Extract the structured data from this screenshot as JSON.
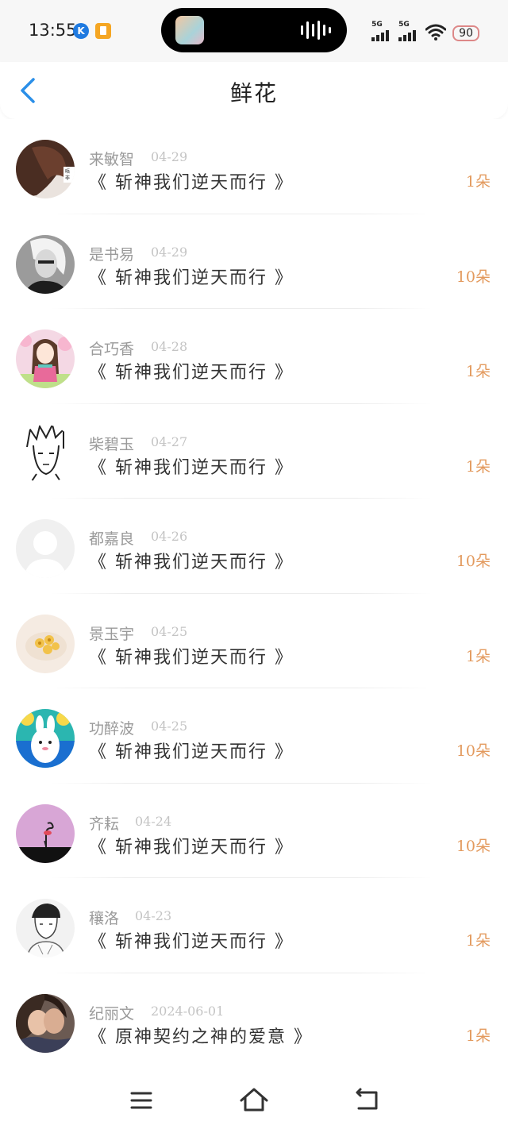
{
  "status_bar": {
    "time": "13:55",
    "k_badge": "K",
    "signal_1": "5G",
    "signal_2": "5G",
    "battery": "90",
    "icons": [
      "k-app-icon",
      "notes-app-icon",
      "wifi-icon",
      "battery-icon"
    ]
  },
  "header": {
    "title": "鲜花",
    "back_icon": "chevron-left-icon",
    "accent_color": "#2b8fe8"
  },
  "items": [
    {
      "name": "来敏智",
      "date": "04-29",
      "book": "《 斩神我们逆天而行 》",
      "count": "1朵",
      "avatar": "avatar-photo-hair"
    },
    {
      "name": "是书易",
      "date": "04-29",
      "book": "《 斩神我们逆天而行 》",
      "count": "10朵",
      "avatar": "avatar-photo-bw"
    },
    {
      "name": "合巧香",
      "date": "04-28",
      "book": "《 斩神我们逆天而行 》",
      "count": "1朵",
      "avatar": "avatar-doll"
    },
    {
      "name": "柴碧玉",
      "date": "04-27",
      "book": "《 斩神我们逆天而行 》",
      "count": "1朵",
      "avatar": "avatar-sketch"
    },
    {
      "name": "都嘉良",
      "date": "04-26",
      "book": "《 斩神我们逆天而行 》",
      "count": "10朵",
      "avatar": "avatar-default"
    },
    {
      "name": "景玉宇",
      "date": "04-25",
      "book": "《 斩神我们逆天而行 》",
      "count": "1朵",
      "avatar": "avatar-food"
    },
    {
      "name": "功醉波",
      "date": "04-25",
      "book": "《 斩神我们逆天而行 》",
      "count": "10朵",
      "avatar": "avatar-cartoon-bunny"
    },
    {
      "name": "齐耘",
      "date": "04-24",
      "book": "《 斩神我们逆天而行 》",
      "count": "10朵",
      "avatar": "avatar-flamingo"
    },
    {
      "name": "穰洛",
      "date": "04-23",
      "book": "《 斩神我们逆天而行 》",
      "count": "1朵",
      "avatar": "avatar-sketch-boy"
    },
    {
      "name": "纪丽文",
      "date": "2024-06-01",
      "book": "《 原神契约之神的爱意 》",
      "count": "1朵",
      "avatar": "avatar-couple"
    }
  ],
  "colors": {
    "count": "#e39a5e",
    "name": "#9a9a9a",
    "date": "#c4c4c4",
    "book": "#333333"
  },
  "bottom_nav": {
    "icons": [
      "menu-icon",
      "home-icon",
      "back-icon"
    ]
  }
}
